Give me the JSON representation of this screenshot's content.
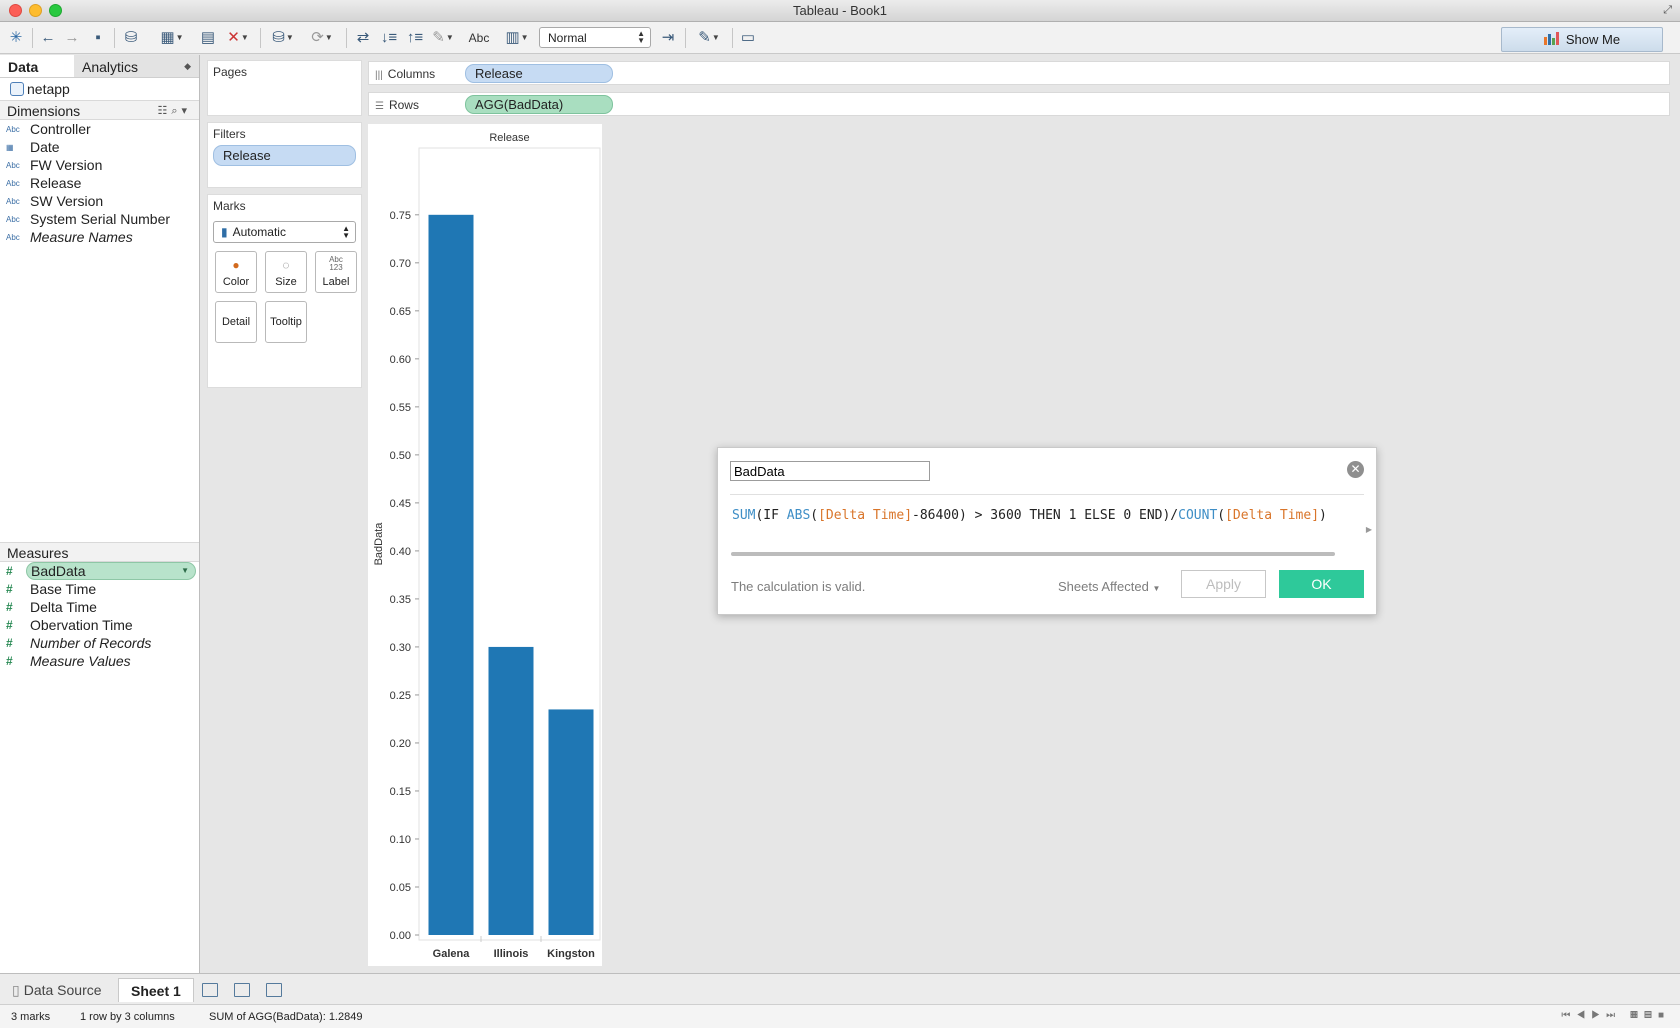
{
  "window": {
    "title": "Tableau - Book1"
  },
  "toolbar": {
    "abc_label": "Abc",
    "view_mode": "Normal",
    "show_me": "Show Me"
  },
  "datapane": {
    "tabs": [
      "Data",
      "Analytics"
    ],
    "datasource": "netapp",
    "dimensions_header": "Dimensions",
    "dimensions": [
      {
        "type": "Abc",
        "name": "Controller"
      },
      {
        "type": "cal",
        "name": "Date"
      },
      {
        "type": "Abc",
        "name": "FW Version"
      },
      {
        "type": "Abc",
        "name": "Release"
      },
      {
        "type": "Abc",
        "name": "SW Version"
      },
      {
        "type": "Abc",
        "name": "System Serial Number"
      },
      {
        "type": "Abc",
        "name": "Measure Names"
      }
    ],
    "measures_header": "Measures",
    "measures": [
      {
        "name": "BadData"
      },
      {
        "name": "Base Time"
      },
      {
        "name": "Delta Time"
      },
      {
        "name": "Obervation Time"
      },
      {
        "name": "Number of Records"
      },
      {
        "name": "Measure Values"
      }
    ]
  },
  "cards": {
    "pages": "Pages",
    "filters": "Filters",
    "filter_pill": "Release",
    "marks": "Marks",
    "marks_type": "Automatic",
    "mark_buttons": [
      "Color",
      "Size",
      "Label",
      "Detail",
      "Tooltip"
    ]
  },
  "shelves": {
    "columns_label": "Columns",
    "columns_pill": "Release",
    "rows_label": "Rows",
    "rows_pill": "AGG(BadData)"
  },
  "chart_data": {
    "type": "bar",
    "title": "Release",
    "ylabel": "BadData",
    "categories": [
      "Galena",
      "Illinois",
      "Kingston"
    ],
    "values": [
      0.75,
      0.3,
      0.2349
    ],
    "ylim": [
      0,
      0.78
    ],
    "yticks": [
      "0.00",
      "0.05",
      "0.10",
      "0.15",
      "0.20",
      "0.25",
      "0.30",
      "0.35",
      "0.40",
      "0.45",
      "0.50",
      "0.55",
      "0.60",
      "0.65",
      "0.70",
      "0.75"
    ],
    "color": "#1f77b4"
  },
  "calc": {
    "name": "BadData",
    "status": "The calculation is valid.",
    "sheets_affected": "Sheets Affected",
    "apply": "Apply",
    "ok": "OK",
    "formula": {
      "sum": "SUM",
      "p1": "(IF ",
      "abs": "ABS",
      "p2": "(",
      "f1": "[Delta Time]",
      "p3": "-86400) > 3600 THEN 1 ELSE 0 END)/",
      "count": "COUNT",
      "p4": "(",
      "f2": "[Delta Time]",
      "p5": ")"
    }
  },
  "sheets": {
    "datasource_tab": "Data Source",
    "active_tab": "Sheet 1"
  },
  "status": {
    "marks": "3 marks",
    "dims": "1 row by 3 columns",
    "sum": "SUM of AGG(BadData): 1.2849"
  }
}
